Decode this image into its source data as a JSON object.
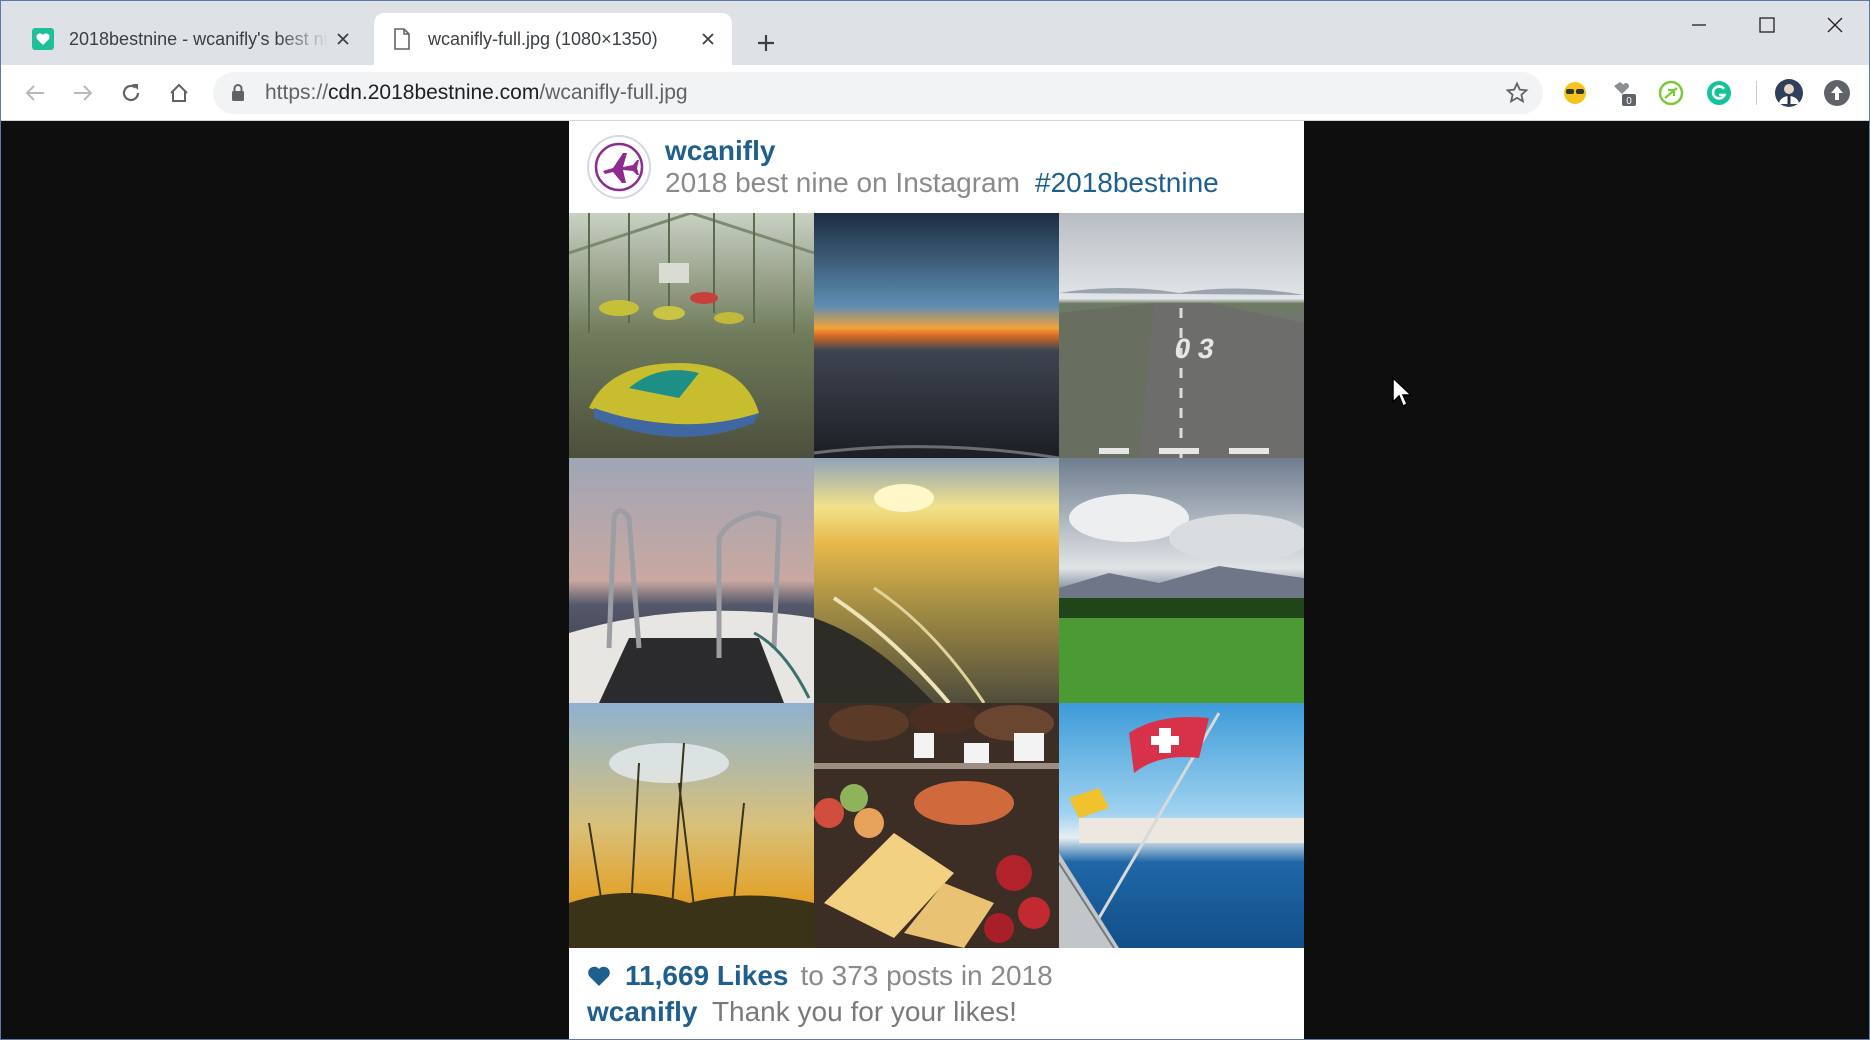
{
  "browser": {
    "tabs": [
      {
        "title": "2018bestnine - wcanifly's best nine",
        "active": false,
        "favicon": "heart-favicon-icon"
      },
      {
        "title": "wcanifly-full.jpg (1080×1350)",
        "active": true,
        "favicon": "document-icon"
      }
    ],
    "url_prefix": "https://",
    "url_host": "cdn.2018bestnine.com",
    "url_path": "/wcanifly-full.jpg",
    "extensions": [
      "sunglasses-extension-icon",
      "puzzle-extension-icon",
      "leaf-extension-icon",
      "grammarly-extension-icon"
    ],
    "extension_badge": "0"
  },
  "card": {
    "username": "wcanifly",
    "subtitle": "2018 best nine on Instagram",
    "hashtag": "#2018bestnine",
    "likes_count": "11,669 Likes",
    "likes_rest": "to 373 posts in 2018",
    "footer_user": "wcanifly",
    "thanks": "Thank you for your likes!",
    "colors": {
      "accent": "#1f5f8e",
      "muted": "#8a8a8a"
    },
    "photos": [
      "abandoned bumper cars in greenhouse",
      "sunset above clouds from airplane",
      "airport runway",
      "boat deck railings at dusk",
      "golden sunset over coast",
      "green field with mountains and clouds",
      "grass silhouettes at sunset",
      "bakery display of tarts and pastries",
      "swiss flag over lake geneva"
    ]
  }
}
